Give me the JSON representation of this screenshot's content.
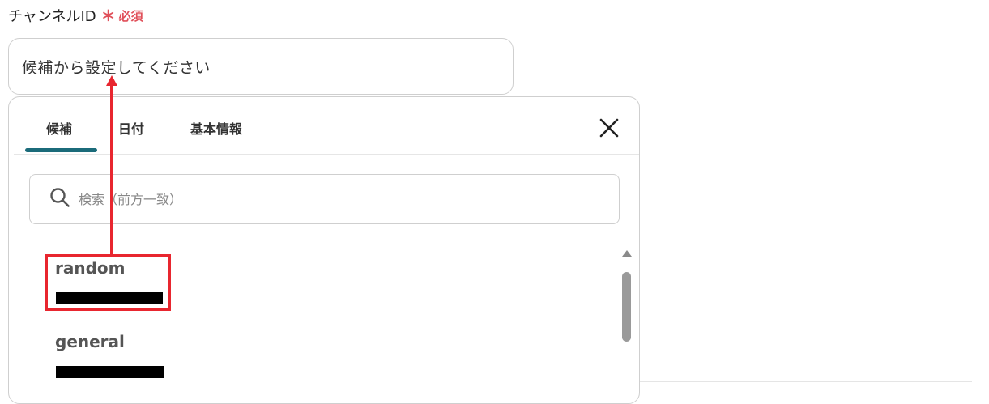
{
  "field": {
    "label": "チャンネルID",
    "required_mark": "＊",
    "required_text": "必須",
    "placeholder": "候補から設定してください"
  },
  "popup": {
    "tabs": [
      {
        "label": "候補",
        "active": true
      },
      {
        "label": "日付",
        "active": false
      },
      {
        "label": "基本情報",
        "active": false
      }
    ],
    "close_icon": "close-icon",
    "search_placeholder": "検索（前方一致）",
    "search_icon": "search-icon",
    "options": [
      {
        "name": "random",
        "detail_redacted": true,
        "highlighted": true
      },
      {
        "name": "general",
        "detail_redacted": true,
        "highlighted": false
      }
    ]
  },
  "colors": {
    "accent": "#1b6b7a",
    "required": "#e0505a",
    "annotation": "#e8262f"
  }
}
